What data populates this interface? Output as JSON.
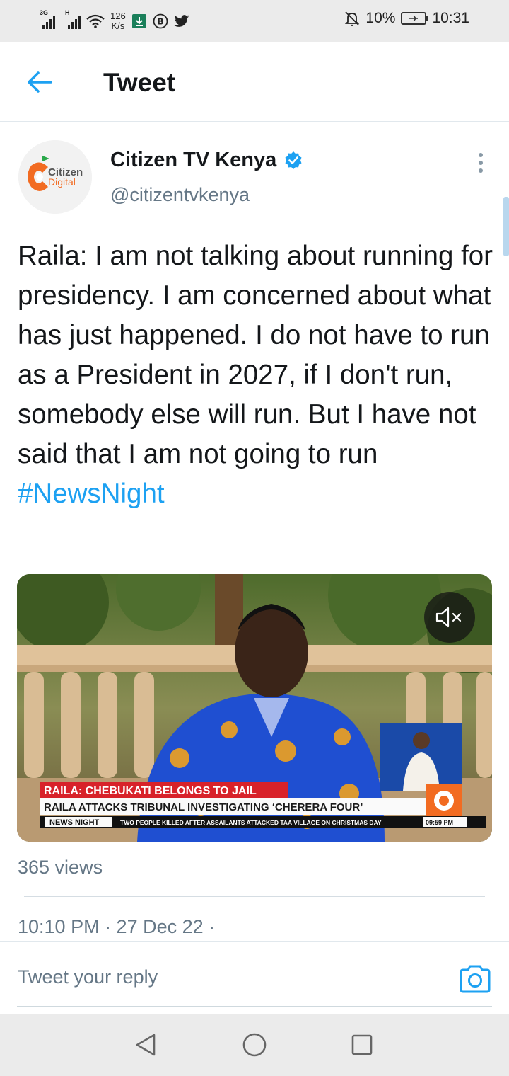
{
  "status_bar": {
    "net1": "3G",
    "net2": "H",
    "speed_value": "126",
    "speed_unit": "K/s",
    "battery_percent": "10%",
    "time": "10:31",
    "icons": [
      "signal-icon",
      "wifi-icon",
      "download-app-icon",
      "b-circle-icon",
      "twitter-bird-icon",
      "mute-bell-icon",
      "battery-icon"
    ]
  },
  "header": {
    "title": "Tweet"
  },
  "tweet": {
    "avatar_text_1": "Citizen",
    "avatar_text_2": "Digital",
    "author_name": "Citizen TV Kenya",
    "verified": true,
    "handle": "@citizentvkenya",
    "text": "Raila: I am not talking about running for presidency. I am concerned about what has just happened. I do not have to run as a President in 2027, if I don't run, somebody else will run. But I have not said that I am not going to run",
    "hashtag": "#NewsNight",
    "media": {
      "type": "video",
      "headline": "RAILA: CHEBUKATI BELONGS TO JAIL",
      "subheadline": "RAILA ATTACKS TRIBUNAL INVESTIGATING ‘CHERERA FOUR’",
      "program": "NEWS NIGHT",
      "ticker": "TWO PEOPLE KILLED AFTER ASSAILANTS ATTACKED TAA VILLAGE ON CHRISTMAS DAY",
      "clock": "09:59 PM",
      "muted": true
    },
    "views": "365 views",
    "timestamp": "10:10 PM · 27 Dec 22 ·"
  },
  "reply": {
    "placeholder": "Tweet your reply"
  },
  "colors": {
    "accent": "#1da1f2",
    "muted_text": "#657786",
    "text": "#14171a",
    "banner_red": "#d8222a"
  }
}
